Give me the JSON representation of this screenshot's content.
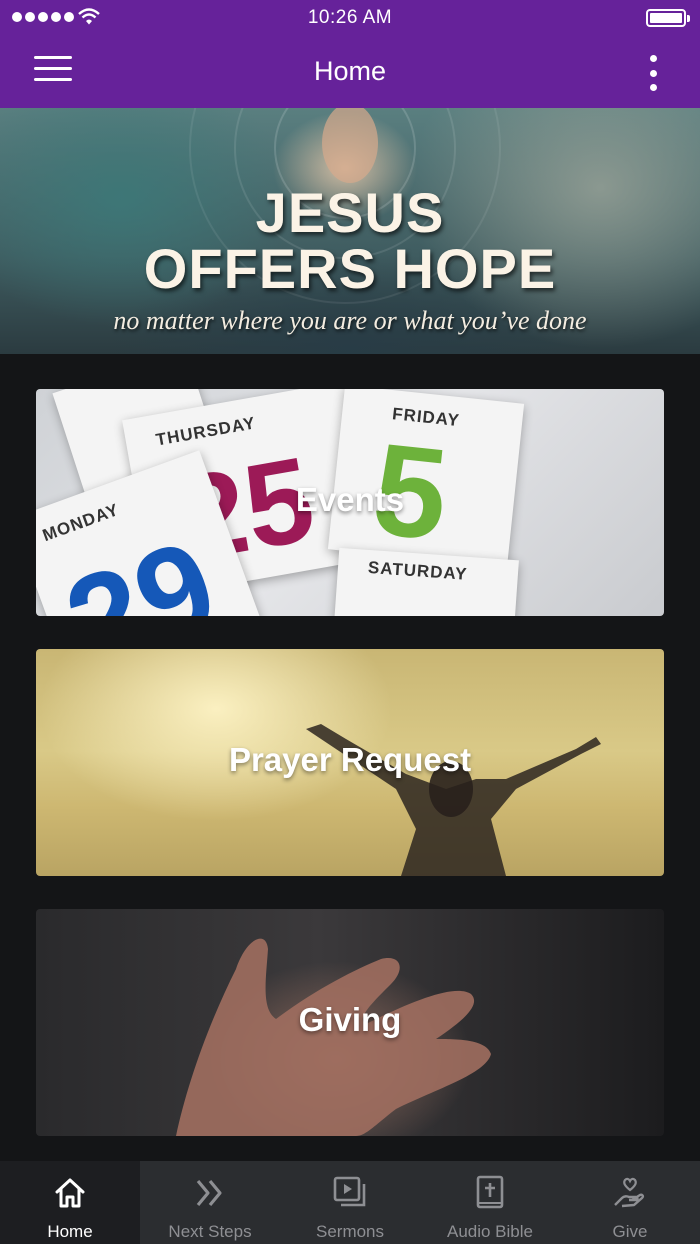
{
  "status_bar": {
    "time": "10:26 AM"
  },
  "header": {
    "title": "Home"
  },
  "hero": {
    "line1": "JESUS",
    "line2": "OFFERS HOPE",
    "subtitle": "no matter where you are or what you’ve done"
  },
  "cards": [
    {
      "label": "Events"
    },
    {
      "label": "Prayer Request"
    },
    {
      "label": "Giving"
    }
  ],
  "events_image": {
    "days": [
      "THURSDAY",
      "FRIDAY",
      "MONDAY",
      "SATURDAY"
    ],
    "numbers": [
      "25",
      "5",
      "29"
    ]
  },
  "tabs": [
    {
      "label": "Home",
      "icon": "home-icon",
      "active": true
    },
    {
      "label": "Next Steps",
      "icon": "double-chevron-icon",
      "active": false
    },
    {
      "label": "Sermons",
      "icon": "video-library-icon",
      "active": false
    },
    {
      "label": "Audio Bible",
      "icon": "bible-icon",
      "active": false
    },
    {
      "label": "Give",
      "icon": "heart-hand-icon",
      "active": false
    }
  ],
  "colors": {
    "header": "#66229a",
    "background": "#141517",
    "tabbar": "#2b2d30",
    "tab_active": "#ffffff",
    "tab_inactive": "#8e8f93"
  }
}
